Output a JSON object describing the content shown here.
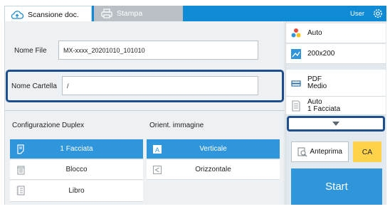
{
  "tabs": {
    "scan_label": "Scansione doc.",
    "print_label": "Stampa"
  },
  "header": {
    "user_label": "User"
  },
  "fields": {
    "file_name_label": "Nome File",
    "file_name_value": "MX-xxxx_20201010_101010",
    "folder_name_label": "Nome Cartella",
    "folder_name_value": "/"
  },
  "duplex": {
    "title": "Configurazione Duplex",
    "options": [
      "1 Facciata",
      "Blocco",
      "Libro"
    ],
    "selected": "1 Facciata"
  },
  "orientation": {
    "title": "Orient. immagine",
    "options": [
      "Verticale",
      "Orizzontale"
    ],
    "selected": "Verticale"
  },
  "right_panel": {
    "color_mode": "Auto",
    "resolution": "200x200",
    "format_line1": "PDF",
    "format_line2": "Medio",
    "duplex_line1": "Auto",
    "duplex_line2": "1 Facciata",
    "preview_label": "Anteprima",
    "ca_label": "CA",
    "start_label": "Start"
  },
  "colors": {
    "accent": "#2f96dc",
    "topbar": "#0f8bd6",
    "highlight_border": "#1f4e8c",
    "ca_button": "#ffd24a"
  }
}
